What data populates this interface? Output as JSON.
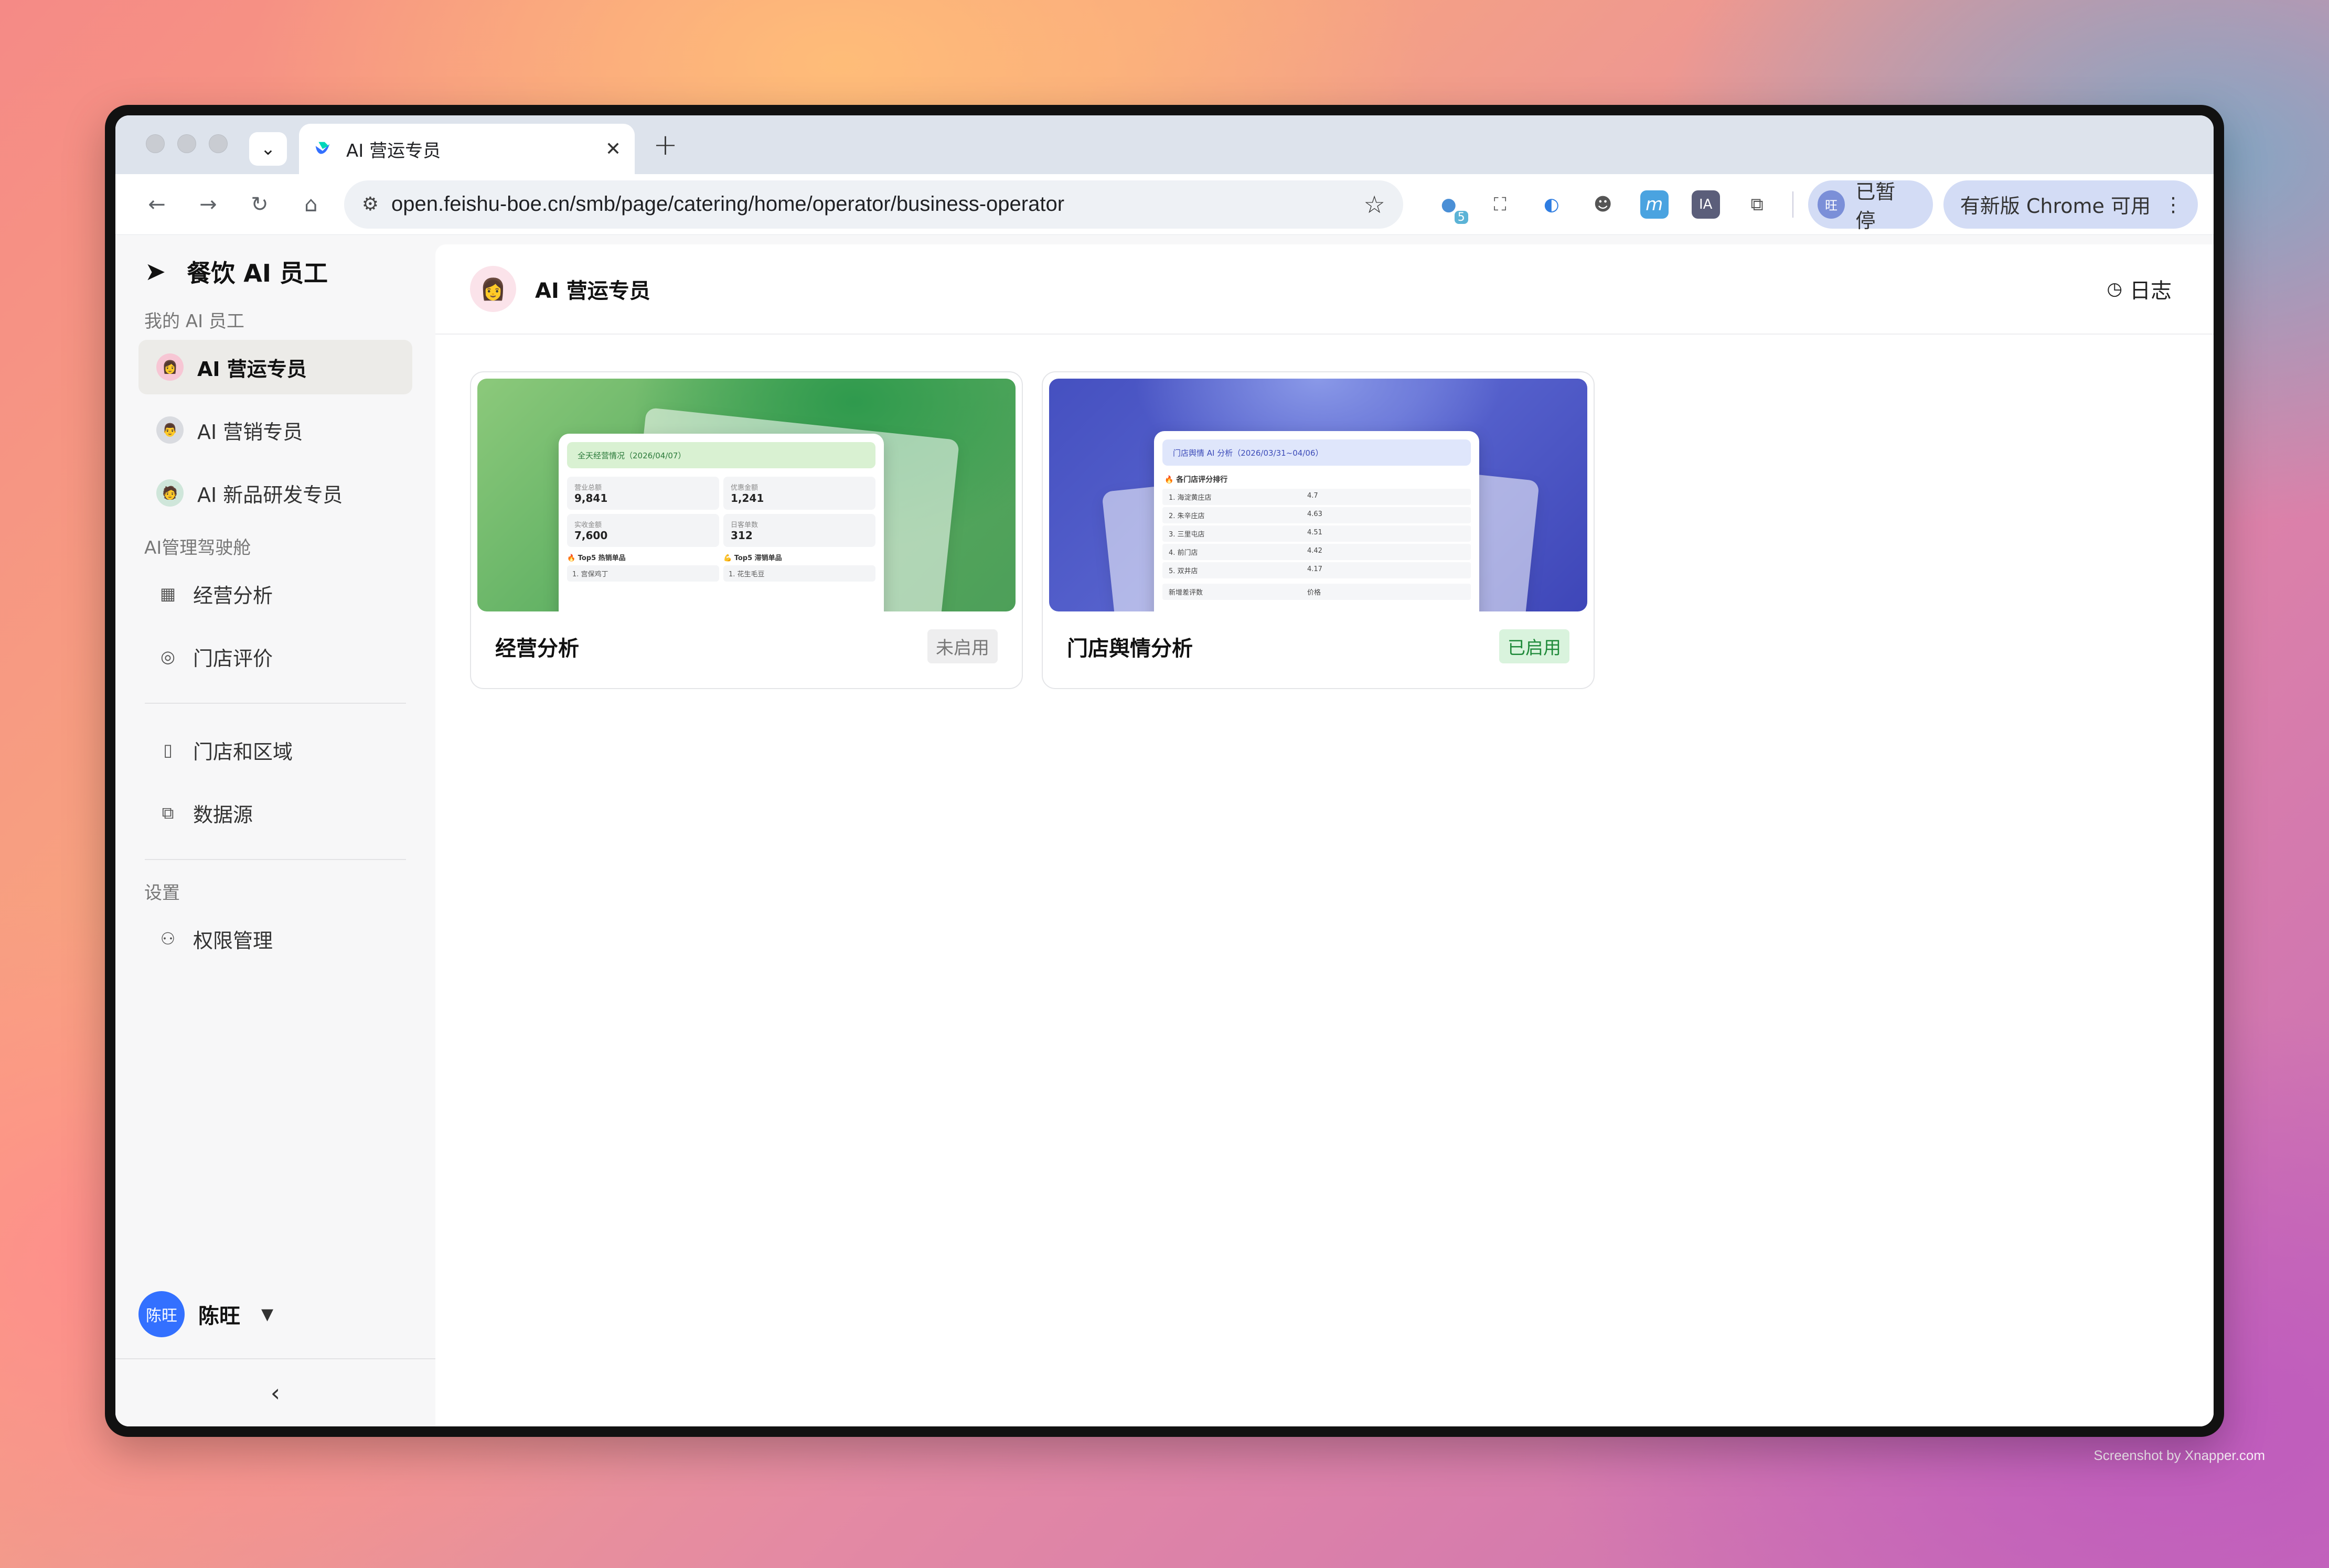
{
  "browser": {
    "tab_title": "AI 营运专员",
    "url": "open.feishu-boe.cn/smb/page/catering/home/operator/business-operator",
    "extension_badge": "5",
    "profile_initial": "旺",
    "profile_status": "已暂停",
    "update_label": "有新版 Chrome 可用",
    "icons": [
      "back-icon",
      "forward-icon",
      "reload-icon",
      "home-icon",
      "site-settings-icon",
      "star-icon",
      "extensions-icon"
    ]
  },
  "sidebar": {
    "brand": "餐饮 AI 员工",
    "groups": [
      {
        "label": "我的 AI 员工",
        "items": [
          {
            "label": "AI 营运专员",
            "active": true
          },
          {
            "label": "AI 营销专员"
          },
          {
            "label": "AI 新品研发专员"
          }
        ]
      },
      {
        "label": "AI管理驾驶舱",
        "items": [
          {
            "label": "经营分析",
            "icon": "chart-icon"
          },
          {
            "label": "门店评价",
            "icon": "rating-icon"
          }
        ]
      },
      {
        "label": "",
        "items": [
          {
            "label": "门店和区域",
            "icon": "building-icon"
          },
          {
            "label": "数据源",
            "icon": "plugin-icon"
          }
        ]
      },
      {
        "label": "设置",
        "items": [
          {
            "label": "权限管理",
            "icon": "users-icon"
          }
        ]
      }
    ],
    "user": {
      "avatar_text": "陈旺",
      "name": "陈旺"
    }
  },
  "header": {
    "title": "AI 营运专员",
    "log_label": "日志"
  },
  "cards": [
    {
      "title": "经营分析",
      "status": "未启用",
      "preview": {
        "title": "全天经营情况（2026/04/07）",
        "metrics": [
          {
            "label": "营业总额",
            "value": "9,841"
          },
          {
            "label": "优惠金额",
            "value": "1,241"
          },
          {
            "label": "实收金额",
            "value": "7,600"
          },
          {
            "label": "日客单数",
            "value": "312"
          }
        ],
        "top_left": "🔥 Top5 热销单品",
        "top_right": "💪 Top5 滞销单品",
        "top_left_item": "1. 宫保鸡丁",
        "top_right_item": "1. 花生毛豆"
      }
    },
    {
      "title": "门店舆情分析",
      "status": "已启用",
      "preview": {
        "title": "门店舆情 AI 分析（2026/03/31~04/06）",
        "rank_title": "🔥 各门店评分排行",
        "rows": [
          {
            "name": "1. 海淀黄庄店",
            "score": "4.7"
          },
          {
            "name": "2. 朱辛庄店",
            "score": "4.63"
          },
          {
            "name": "3. 三里屯店",
            "score": "4.51"
          },
          {
            "name": "4. 前门店",
            "score": "4.42"
          },
          {
            "name": "5. 双井店",
            "score": "4.17"
          }
        ],
        "foot_left": "新增差评数",
        "foot_right": "价格"
      }
    }
  ],
  "watermark": "Screenshot by Xnapper.com"
}
